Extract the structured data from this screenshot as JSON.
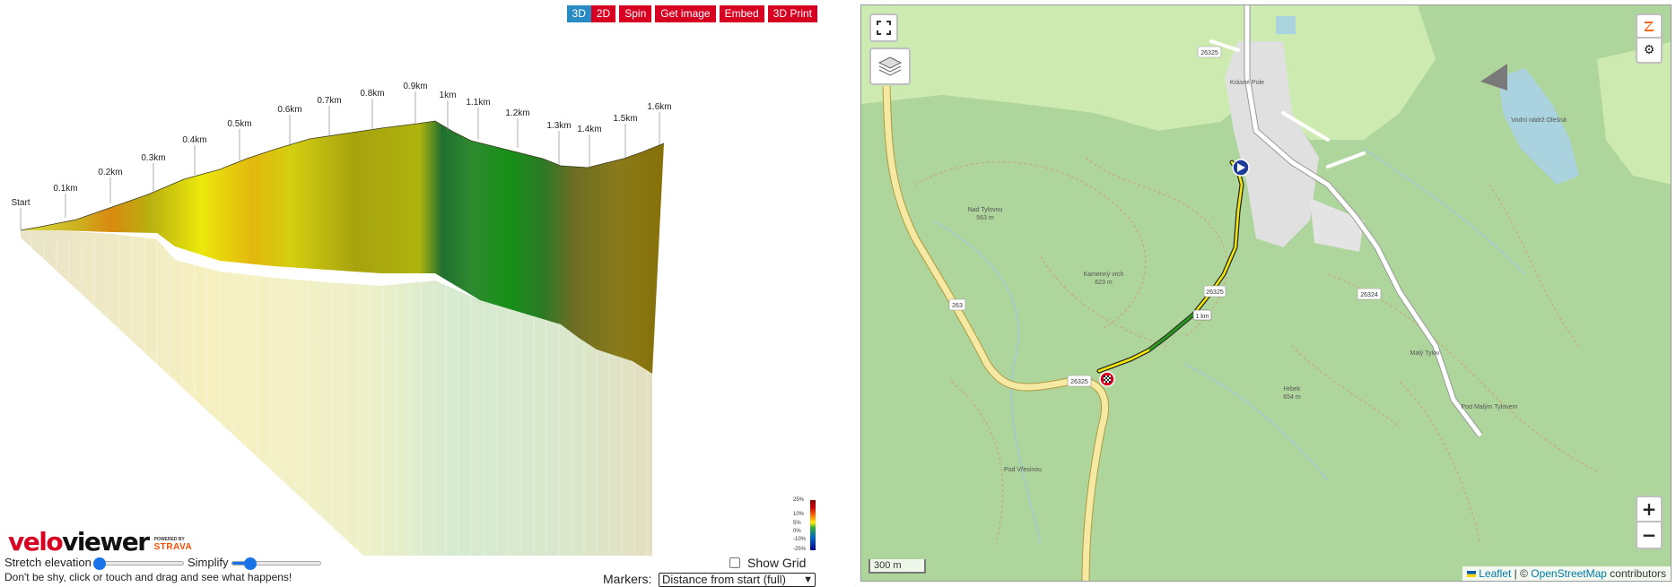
{
  "toolbar": {
    "view_3d": "3D",
    "view_2d": "2D",
    "spin": "Spin",
    "get_image": "Get image",
    "embed": "Embed",
    "print_3d": "3D Print"
  },
  "profile": {
    "markers": [
      "Start",
      "0.1km",
      "0.2km",
      "0.3km",
      "0.4km",
      "0.5km",
      "0.6km",
      "0.7km",
      "0.8km",
      "0.9km",
      "1km",
      "1.1km",
      "1.2km",
      "1.3km",
      "1.4km",
      "1.5km",
      "1.6km"
    ],
    "gradient_legend": [
      "25%",
      "10%",
      "5%",
      "0%",
      "-10%",
      "-25%"
    ],
    "colors": {
      "climb_yellow": "#e8dd12",
      "climb_olive": "#9a9a10",
      "climb_orange": "#d98a10",
      "descent_green": "#1f8a1f",
      "descent_dark": "#3a6a3a"
    }
  },
  "brand": {
    "logo_part1": "velo",
    "logo_part2": "viewer",
    "powered_by": "POWERED BY",
    "strava": "STRAVA"
  },
  "controls": {
    "stretch_label": "Stretch elevation",
    "simplify_label": "Simplify",
    "show_grid_label": "Show Grid ()",
    "hint": "Don't be shy, click or touch and drag and see what happens!",
    "markers_label": "Markers:",
    "markers_value": "Distance from start (full)"
  },
  "map": {
    "places": {
      "town": "Krásné Pole",
      "hill1": "Nad Tylovou",
      "hill1_elev": "563 m",
      "hill2": "Kamenný vrch",
      "hill2_elev": "623 m",
      "hill3": "Hrbek",
      "hill3_elev": "654 m",
      "hill4": "Malý Tylov",
      "hill5": "Pod Malým Tylovem",
      "reservoir": "Vodní nádrž Olešná",
      "forest_road": "Pod Vřesinou"
    },
    "roads": [
      "26325",
      "263",
      "26325",
      "26324",
      "26325"
    ],
    "route_km_marker": "1 km",
    "scale": "300 m",
    "attribution_leaflet": "Leaflet",
    "attribution_sep": " | © ",
    "attribution_osm": "OpenStreetMap",
    "attribution_suffix": " contributors",
    "zoom_in": "+",
    "zoom_out": "−",
    "colors": {
      "forest": "#aed59b",
      "meadow": "#cdebb0",
      "residential": "#e0e0e0",
      "water": "#aad3df",
      "primary_road": "#f6e9a3",
      "route_yellow": "#f3e60a",
      "route_green": "#1f9a1f",
      "marker_start": "#1e3c96",
      "marker_finish": "#d70021"
    }
  }
}
